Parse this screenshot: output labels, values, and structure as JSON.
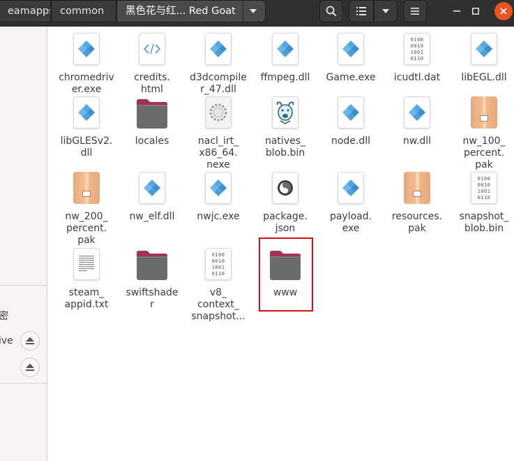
{
  "header": {
    "breadcrumbs": [
      {
        "label": "eamapps"
      },
      {
        "label": "common"
      },
      {
        "label": "黑色花与红... Red Goat"
      }
    ]
  },
  "sidebar": {
    "partial_label_1": "密",
    "partial_label_2": "ive"
  },
  "files": [
    {
      "name": "chromedriver.exe",
      "label": "chromedriv\ner.exe",
      "type": "exe"
    },
    {
      "name": "credits.html",
      "label": "credits.\nhtml",
      "type": "html"
    },
    {
      "name": "d3dcompiler_47.dll",
      "label": "d3dcompile\nr_47.dll",
      "type": "exe"
    },
    {
      "name": "ffmpeg.dll",
      "label": "ffmpeg.dll",
      "type": "exe"
    },
    {
      "name": "Game.exe",
      "label": "Game.exe",
      "type": "exe"
    },
    {
      "name": "icudtl.dat",
      "label": "icudtl.dat",
      "type": "binary"
    },
    {
      "name": "libEGL.dll",
      "label": "libEGL.dll",
      "type": "exe"
    },
    {
      "name": "libGLESv2.dll",
      "label": "libGLESv2.\ndll",
      "type": "exe"
    },
    {
      "name": "locales",
      "label": "locales",
      "type": "folder"
    },
    {
      "name": "nacl_irt_x86_64.nexe",
      "label": "nacl_irt_\nx86_64.\nnexe",
      "type": "gear"
    },
    {
      "name": "natives_blob.bin",
      "label": "natives_\nblob.bin",
      "type": "goat"
    },
    {
      "name": "node.dll",
      "label": "node.dll",
      "type": "exe"
    },
    {
      "name": "nw.dll",
      "label": "nw.dll",
      "type": "exe"
    },
    {
      "name": "nw_100_percent.pak",
      "label": "nw_100_\npercent.\npak",
      "type": "pak"
    },
    {
      "name": "nw_200_percent.pak",
      "label": "nw_200_\npercent.\npak",
      "type": "pak"
    },
    {
      "name": "nw_elf.dll",
      "label": "nw_elf.dll",
      "type": "exe"
    },
    {
      "name": "nwjc.exe",
      "label": "nwjc.exe",
      "type": "exe"
    },
    {
      "name": "package.json",
      "label": "package.\njson",
      "type": "json"
    },
    {
      "name": "payload.exe",
      "label": "payload.\nexe",
      "type": "exe"
    },
    {
      "name": "resources.pak",
      "label": "resources.\npak",
      "type": "pak"
    },
    {
      "name": "snapshot_blob.bin",
      "label": "snapshot_\nblob.bin",
      "type": "binary"
    },
    {
      "name": "steam_appid.txt",
      "label": "steam_\nappid.txt",
      "type": "text"
    },
    {
      "name": "swiftshader",
      "label": "swiftshade\nr",
      "type": "folder"
    },
    {
      "name": "v8_context_snapshot.bin",
      "label": "v8_\ncontext_\nsnapshot...",
      "type": "binary"
    },
    {
      "name": "www",
      "label": "www",
      "type": "folder",
      "highlighted": true
    }
  ],
  "icons": {
    "search": "search-icon",
    "view_list": "list-view-icon",
    "view_options": "chevron-down-icon",
    "menu": "hamburger-menu-icon",
    "minimize": "minimize-icon",
    "maximize": "maximize-icon",
    "close": "close-icon",
    "eject": "eject-icon"
  },
  "colors": {
    "headerbar": "#303030",
    "close_button": "#e95420",
    "folder_body": "#6b6b6b",
    "folder_tab": "#a5315a",
    "highlight_box": "#d0121b",
    "exe_icon": "#4a9fd8"
  },
  "binary_glyph": "0100\n0010\n1001\n0110"
}
